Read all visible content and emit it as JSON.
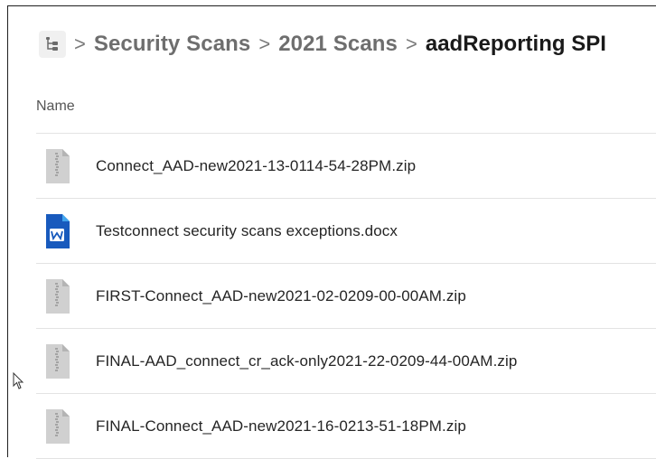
{
  "breadcrumb": {
    "home_icon": "folder-tree-icon",
    "items": [
      "Security Scans",
      "2021 Scans"
    ],
    "current": "aadReporting SPI",
    "separator": ">"
  },
  "list": {
    "header_name": "Name",
    "files": [
      {
        "name": "Connect_AAD-new2021-13-0114-54-28PM.zip",
        "icon": "zip-file-icon"
      },
      {
        "name": "Testconnect security scans exceptions.docx",
        "icon": "word-document-icon"
      },
      {
        "name": "FIRST-Connect_AAD-new2021-02-0209-00-00AM.zip",
        "icon": "zip-file-icon"
      },
      {
        "name": "FINAL-AAD_connect_cr_ack-only2021-22-0209-44-00AM.zip",
        "icon": "zip-file-icon"
      },
      {
        "name": "FINAL-Connect_AAD-new2021-16-0213-51-18PM.zip",
        "icon": "zip-file-icon"
      }
    ]
  },
  "colors": {
    "word_blue": "#185abd",
    "zip_gray": "#c8c8c8"
  }
}
